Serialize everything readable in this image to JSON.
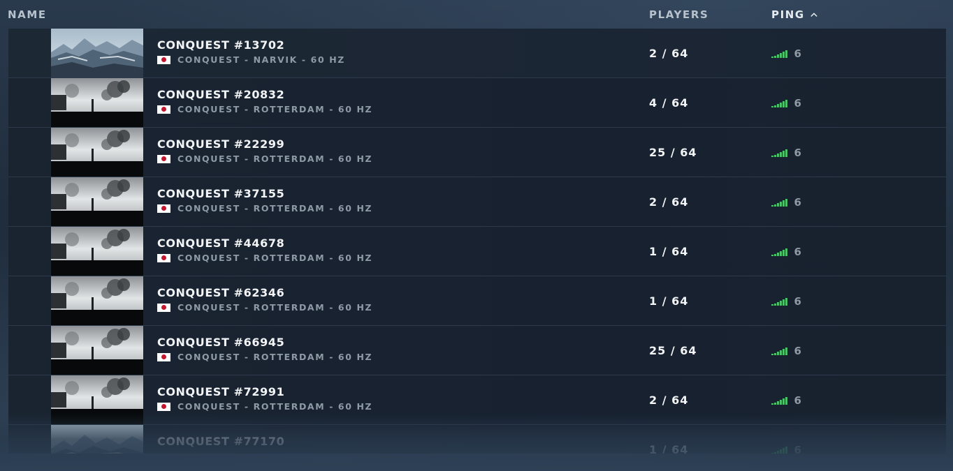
{
  "header": {
    "name_label": "NAME",
    "players_label": "PLAYERS",
    "ping_label": "PING",
    "sort_icon": "chevron-up-icon"
  },
  "colors": {
    "ping_good": "#4ac26b",
    "flag_red": "#c4162f"
  },
  "servers": [
    {
      "title": "CONQUEST #13702",
      "subtitle": "CONQUEST - NARVIK - 60 HZ",
      "players": "2 / 64",
      "ping": "6",
      "map": "narvik",
      "region_flag": "japan-flag-icon"
    },
    {
      "title": "CONQUEST #20832",
      "subtitle": "CONQUEST - ROTTERDAM - 60 HZ",
      "players": "4 / 64",
      "ping": "6",
      "map": "rotterdam",
      "region_flag": "japan-flag-icon"
    },
    {
      "title": "CONQUEST #22299",
      "subtitle": "CONQUEST - ROTTERDAM - 60 HZ",
      "players": "25 / 64",
      "ping": "6",
      "map": "rotterdam",
      "region_flag": "japan-flag-icon"
    },
    {
      "title": "CONQUEST #37155",
      "subtitle": "CONQUEST - ROTTERDAM - 60 HZ",
      "players": "2 / 64",
      "ping": "6",
      "map": "rotterdam",
      "region_flag": "japan-flag-icon"
    },
    {
      "title": "CONQUEST #44678",
      "subtitle": "CONQUEST - ROTTERDAM - 60 HZ",
      "players": "1 / 64",
      "ping": "6",
      "map": "rotterdam",
      "region_flag": "japan-flag-icon"
    },
    {
      "title": "CONQUEST #62346",
      "subtitle": "CONQUEST - ROTTERDAM - 60 HZ",
      "players": "1 / 64",
      "ping": "6",
      "map": "rotterdam",
      "region_flag": "japan-flag-icon"
    },
    {
      "title": "CONQUEST #66945",
      "subtitle": "CONQUEST - ROTTERDAM - 60 HZ",
      "players": "25 / 64",
      "ping": "6",
      "map": "rotterdam",
      "region_flag": "japan-flag-icon"
    },
    {
      "title": "CONQUEST #72991",
      "subtitle": "CONQUEST - ROTTERDAM - 60 HZ",
      "players": "2 / 64",
      "ping": "6",
      "map": "rotterdam",
      "region_flag": "japan-flag-icon"
    },
    {
      "title": "CONQUEST #77170",
      "subtitle": "",
      "players": "1 / 64",
      "ping": "6",
      "map": "narvik",
      "region_flag": "japan-flag-icon"
    }
  ]
}
